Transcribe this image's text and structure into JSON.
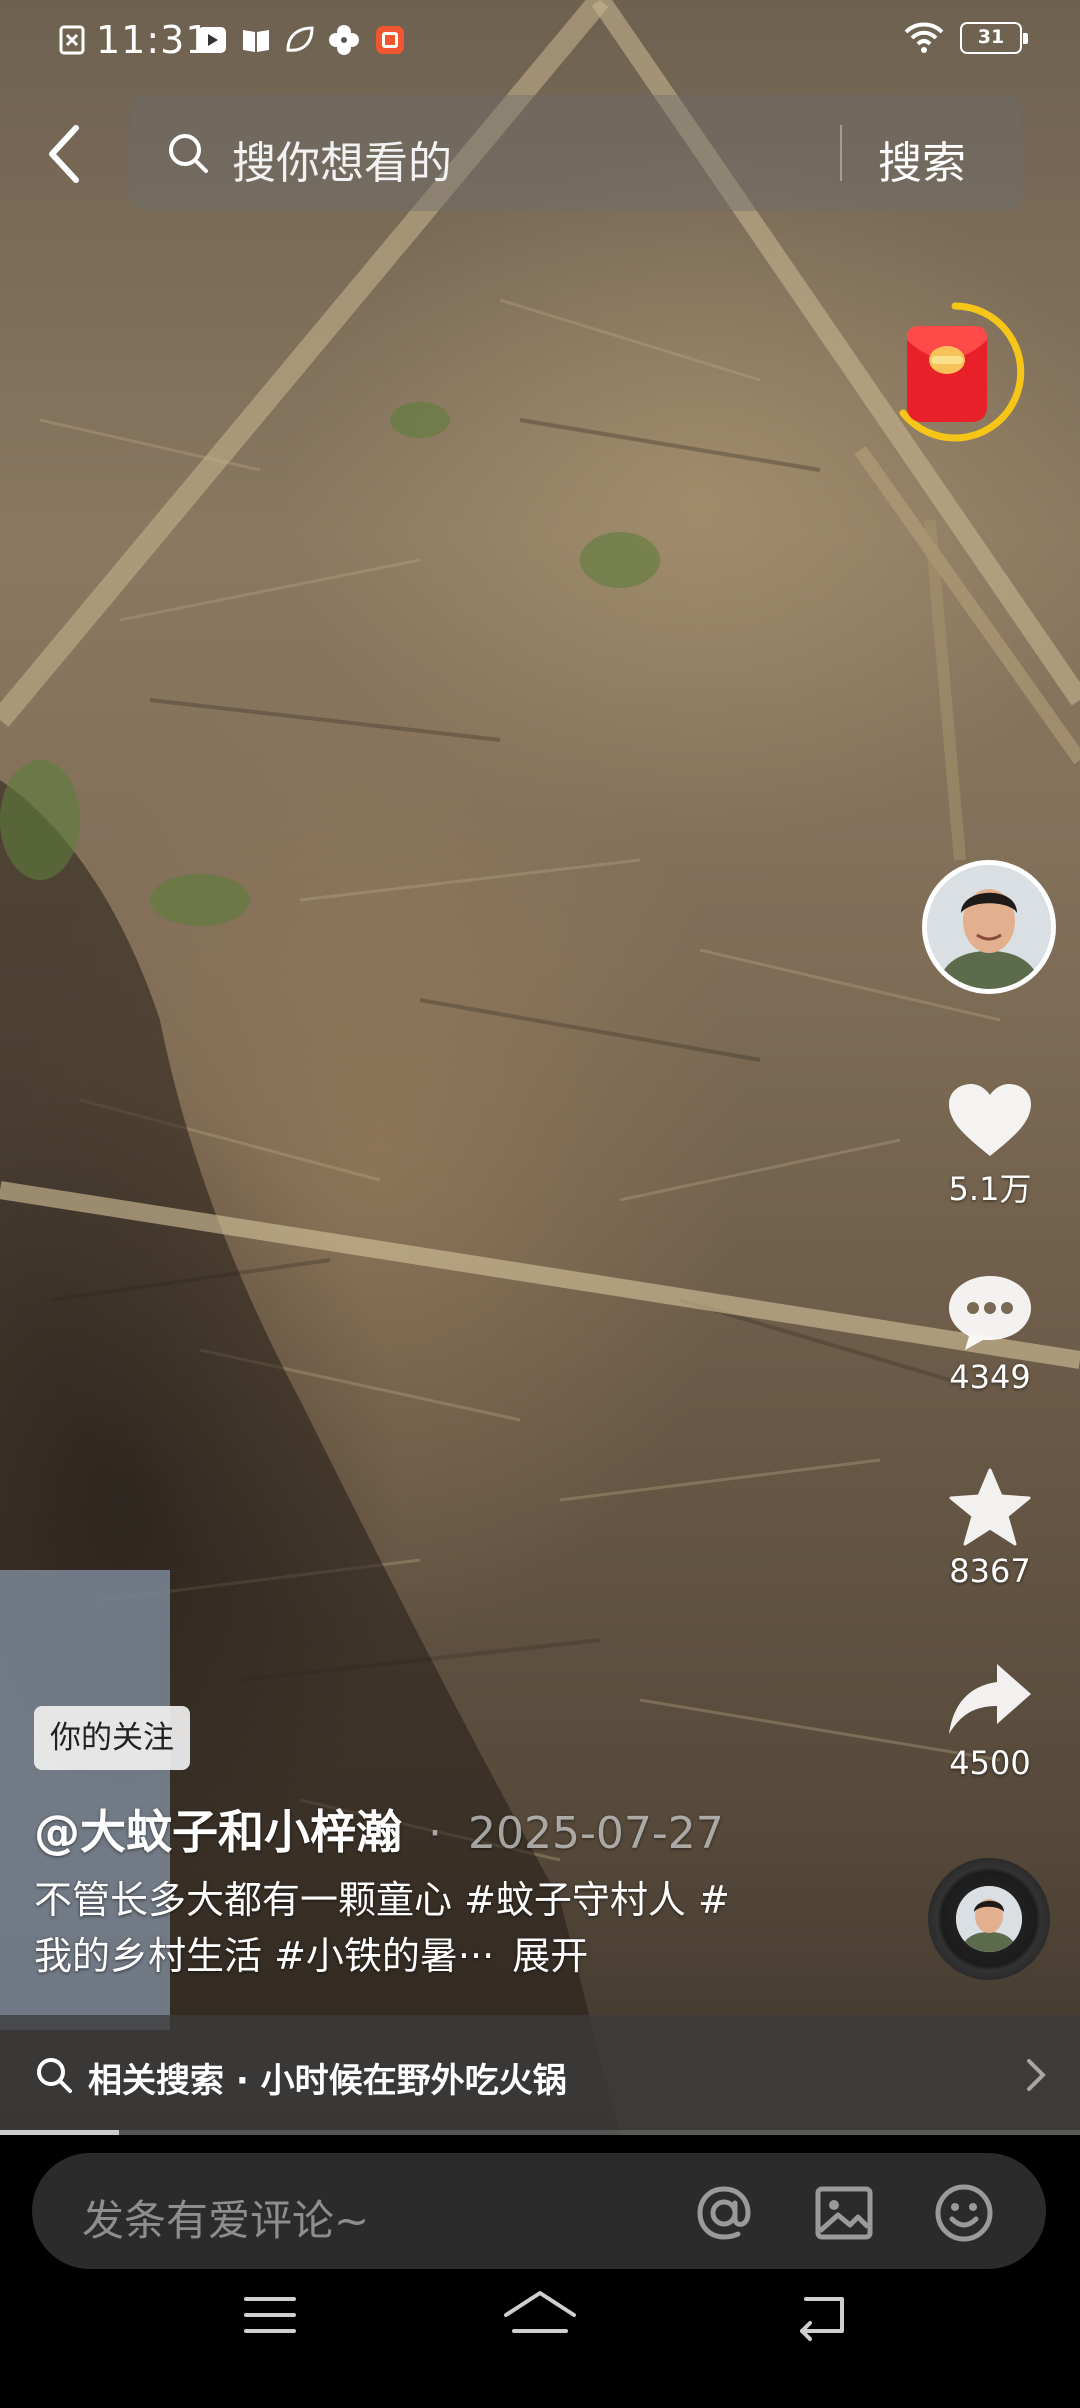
{
  "status_bar": {
    "time": "11:31",
    "battery": "31",
    "icons": [
      "notification-x-icon",
      "video-app-icon",
      "book-app-icon",
      "leaf-app-icon",
      "fan-app-icon",
      "red-app-icon",
      "wifi-icon",
      "battery-icon"
    ]
  },
  "top_search": {
    "placeholder": "搜你想看的",
    "button": "搜索"
  },
  "rail": {
    "likes": "5.1万",
    "comments": "4349",
    "favorites": "8367",
    "shares": "4500"
  },
  "video_info": {
    "follow_tag": "你的关注",
    "author": "@大蚊子和小梓瀚",
    "date_sep": "·",
    "date": "2025-07-27",
    "caption": "不管长多大都有一颗童心 #蚊子守村人 #我的乡村生活 #小铁的暑···",
    "expand": "展开"
  },
  "related_search": {
    "text": "相关搜索 · 小时候在野外吃火锅",
    "progress": 0.11
  },
  "comment_bar": {
    "placeholder": "发条有爱评论~"
  },
  "colors": {
    "accent_yellow": "#f5c518",
    "red_packet": "#e8202a"
  }
}
